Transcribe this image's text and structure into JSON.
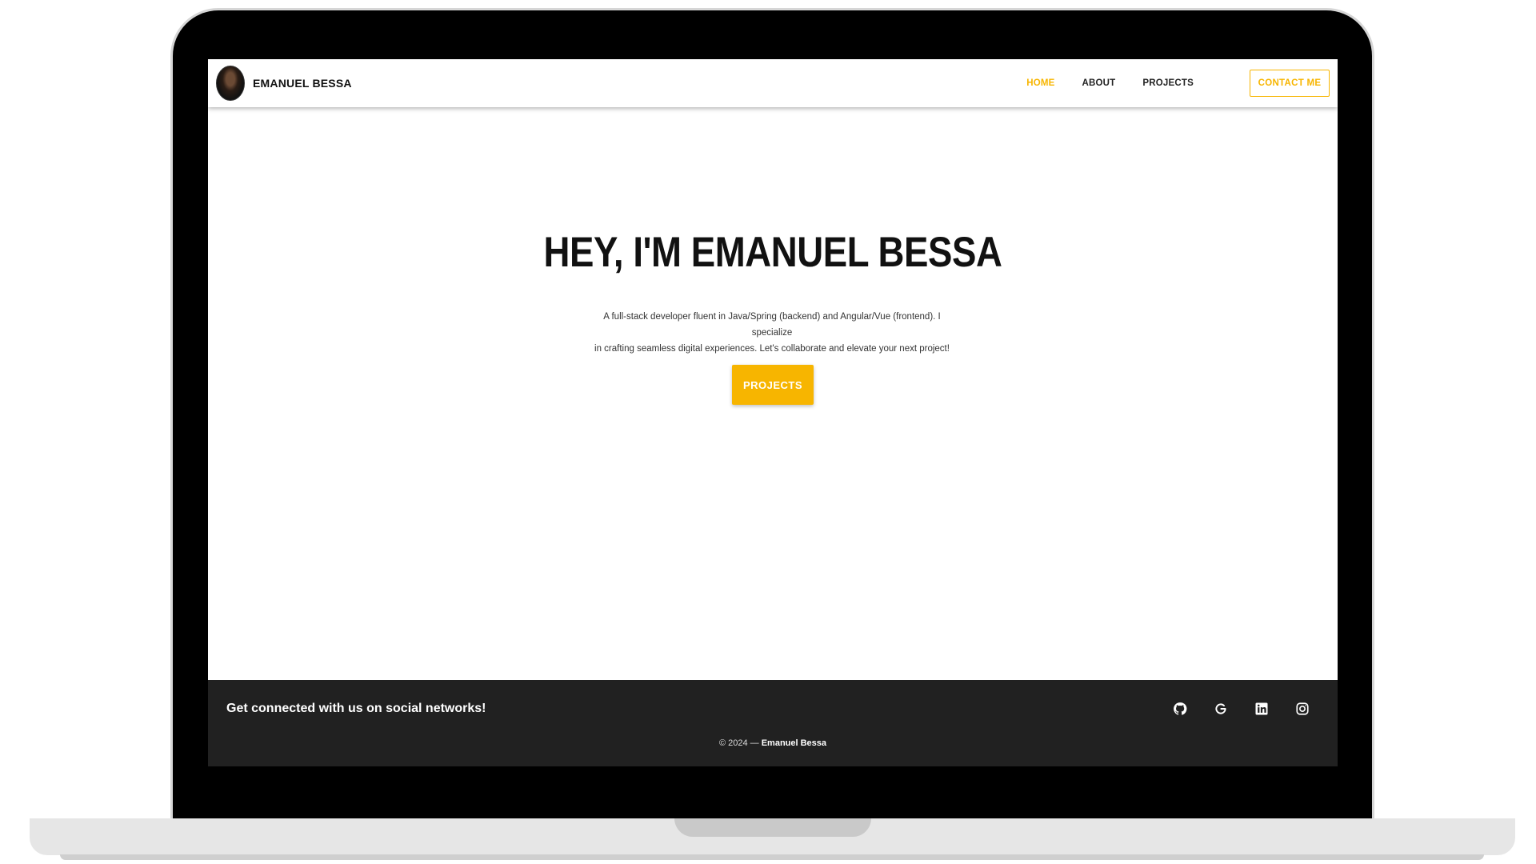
{
  "navbar": {
    "brand_name": "EMANUEL BESSA",
    "links": [
      {
        "label": "HOME",
        "active": true
      },
      {
        "label": "ABOUT",
        "active": false
      },
      {
        "label": "PROJECTS",
        "active": false
      }
    ],
    "contact_label": "CONTACT ME"
  },
  "hero": {
    "title": "HEY, I'M EMANUEL BESSA",
    "description_line1": "A full-stack developer fluent in Java/Spring (backend) and Angular/Vue (frontend). I specialize",
    "description_line2": "in crafting seamless digital experiences. Let's collaborate and elevate your next project!",
    "button_label": "PROJECTS"
  },
  "footer": {
    "tagline": "Get connected with us on social networks!",
    "copyright_prefix": "© 2024 — ",
    "copyright_name": "Emanuel Bessa",
    "social_icons": [
      "github-icon",
      "google-icon",
      "linkedin-icon",
      "instagram-icon"
    ]
  },
  "colors": {
    "accent": "#f7b500",
    "footer_bg": "#212121",
    "text_dark": "#111111"
  }
}
